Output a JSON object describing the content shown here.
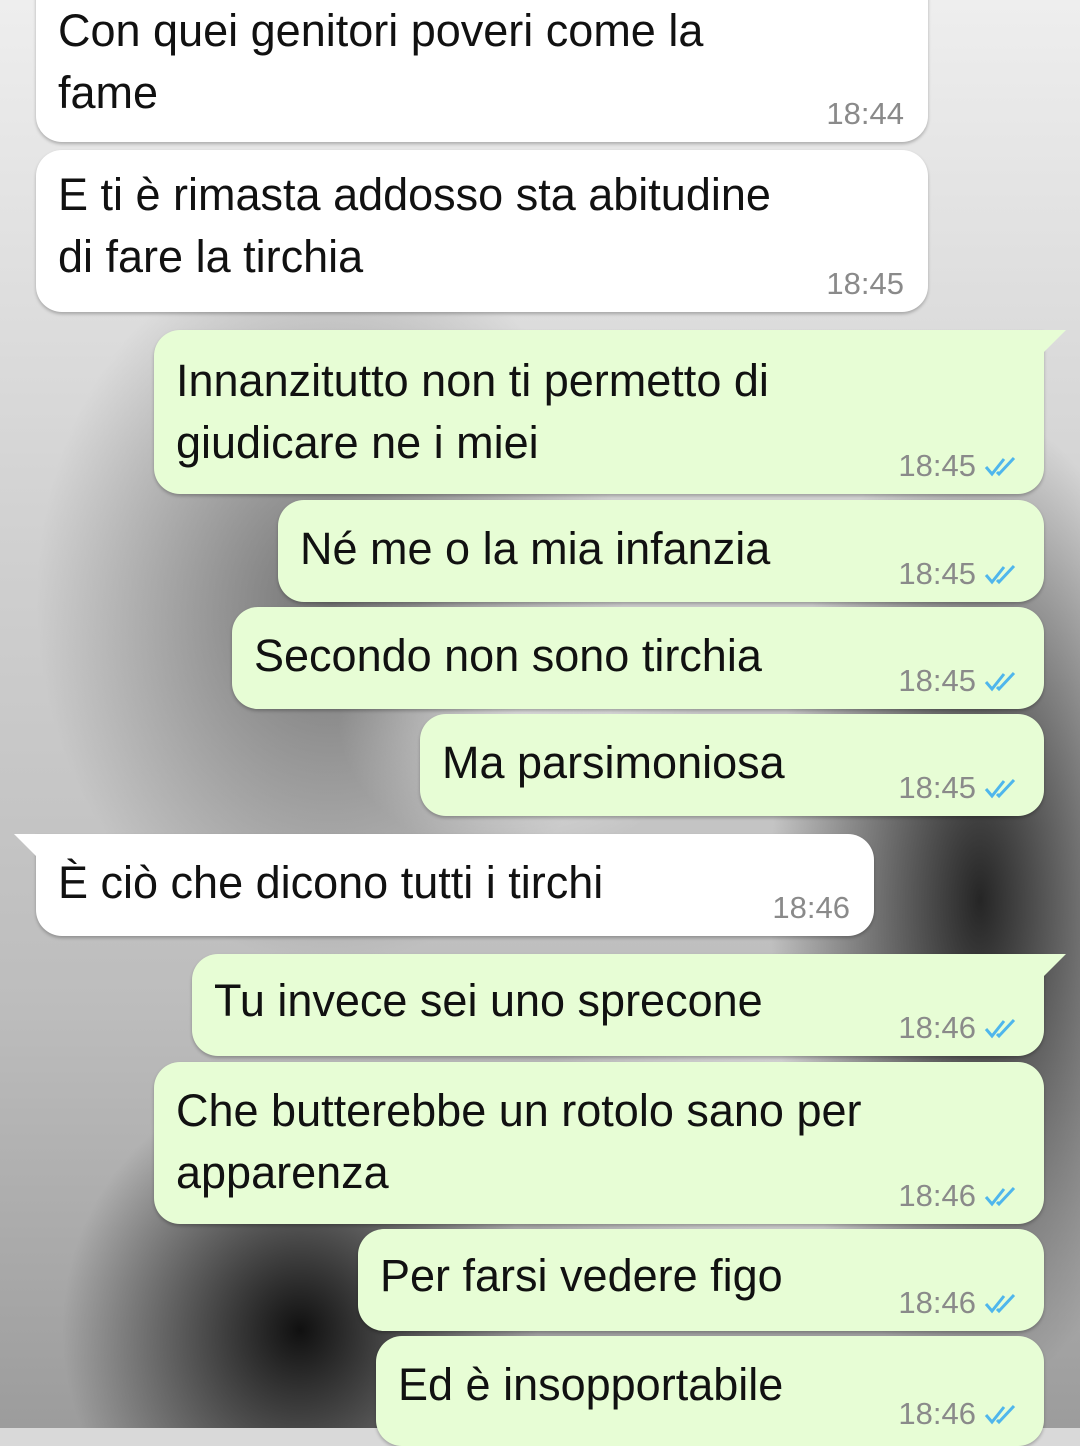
{
  "colors": {
    "incoming_bubble": "#ffffff",
    "outgoing_bubble": "#e7fdd5",
    "timestamp": "#8a8a8a",
    "read_ticks": "#4fb6ec"
  },
  "messages": [
    {
      "direction": "in",
      "text": "Con quei genitori poveri come la\nfame",
      "time": "18:44"
    },
    {
      "direction": "in",
      "text": "E ti è rimasta addosso sta abitudine\ndi fare la tirchia",
      "time": "18:45"
    },
    {
      "direction": "out",
      "text": "Innanzitutto non ti permetto di\ngiudicare ne i miei",
      "time": "18:45",
      "status_icon": "double-check-read"
    },
    {
      "direction": "out",
      "text": "Né me o la mia infanzia",
      "time": "18:45",
      "status_icon": "double-check-read"
    },
    {
      "direction": "out",
      "text": "Secondo non sono tirchia",
      "time": "18:45",
      "status_icon": "double-check-read"
    },
    {
      "direction": "out",
      "text": "Ma parsimoniosa",
      "time": "18:45",
      "status_icon": "double-check-read"
    },
    {
      "direction": "in",
      "text": "È ciò che dicono tutti i tirchi",
      "time": "18:46"
    },
    {
      "direction": "out",
      "text": "Tu invece sei uno sprecone",
      "time": "18:46",
      "status_icon": "double-check-read"
    },
    {
      "direction": "out",
      "text": "Che butterebbe un rotolo sano per\napparenza",
      "time": "18:46",
      "status_icon": "double-check-read"
    },
    {
      "direction": "out",
      "text": "Per farsi vedere figo",
      "time": "18:46",
      "status_icon": "double-check-read"
    },
    {
      "direction": "out",
      "text": "Ed è insopportabile",
      "time": "18:46",
      "status_icon": "double-check-read"
    }
  ]
}
